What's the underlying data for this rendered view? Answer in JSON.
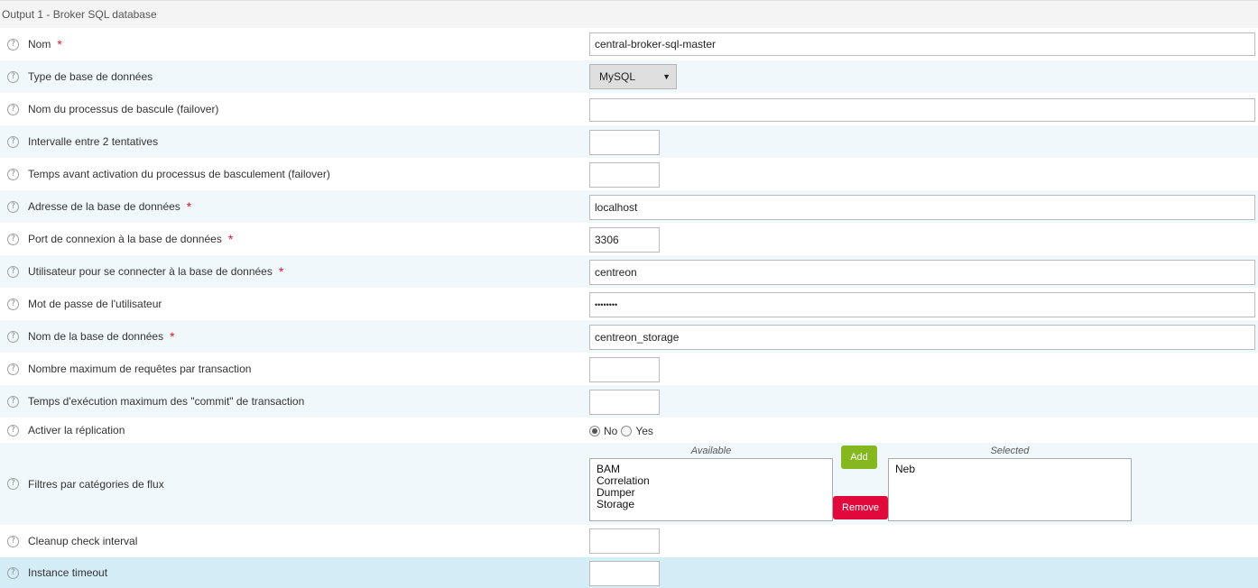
{
  "header": {
    "title": "Output 1 - Broker SQL database"
  },
  "fields": {
    "name": {
      "label": "Nom",
      "value": "central-broker-sql-master"
    },
    "db_type": {
      "label": "Type de base de données",
      "value": "MySQL"
    },
    "failover_name": {
      "label": "Nom du processus de bascule (failover)",
      "value": ""
    },
    "retry_interval": {
      "label": "Intervalle entre 2 tentatives",
      "value": ""
    },
    "failover_delay": {
      "label": "Temps avant activation du processus de basculement (failover)",
      "value": ""
    },
    "db_host": {
      "label": "Adresse de la base de données",
      "value": "localhost"
    },
    "db_port": {
      "label": "Port de connexion à la base de données",
      "value": "3306"
    },
    "db_user": {
      "label": "Utilisateur pour se connecter à la base de données",
      "value": "centreon"
    },
    "db_password": {
      "label": "Mot de passe de l'utilisateur",
      "value": "••••••••"
    },
    "db_name": {
      "label": "Nom de la base de données",
      "value": "centreon_storage"
    },
    "queries_per_transaction": {
      "label": "Nombre maximum de requêtes par transaction",
      "value": ""
    },
    "commit_timeout": {
      "label": "Temps d'exécution maximum des \"commit\" de transaction",
      "value": ""
    },
    "replication": {
      "label": "Activer la réplication",
      "no_label": "No",
      "yes_label": "Yes",
      "selected": "No"
    },
    "filters": {
      "label": "Filtres par catégories de flux",
      "available_caption": "Available",
      "selected_caption": "Selected",
      "available": [
        "BAM",
        "Correlation",
        "Dumper",
        "Storage"
      ],
      "selected": [
        "Neb"
      ],
      "add_label": "Add",
      "remove_label": "Remove"
    },
    "cleanup_interval": {
      "label": "Cleanup check interval",
      "value": ""
    },
    "instance_timeout": {
      "label": "Instance timeout",
      "value": ""
    }
  },
  "required_mark": "*",
  "help_glyph": "?",
  "select_arrow": "▼",
  "colors": {
    "add_button": "#85b81f",
    "remove_button": "#e0093b",
    "required": "#e0182d",
    "row_alt": "#f1f8fb",
    "row_highlight": "#d3ecf6"
  }
}
